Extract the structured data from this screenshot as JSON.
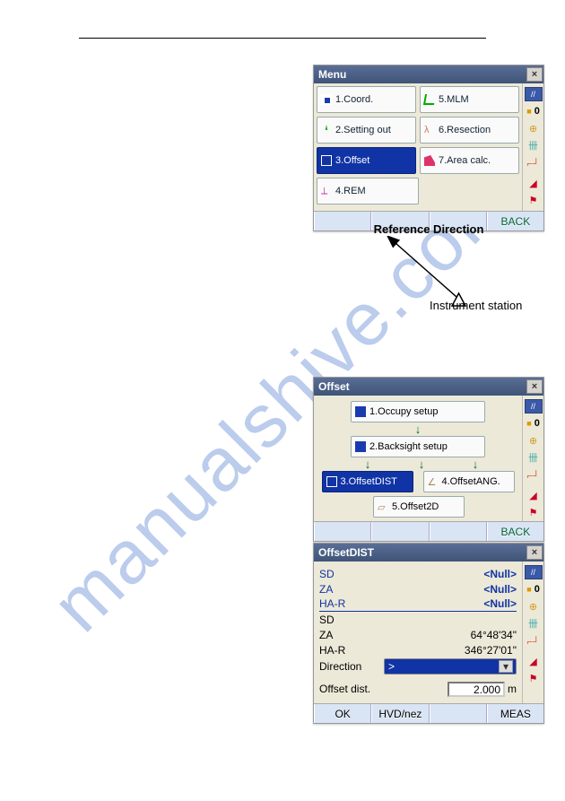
{
  "watermark": "manualshive.com",
  "screens": {
    "menu": {
      "title": "Menu",
      "items": [
        {
          "label": "1.Coord.",
          "icon": "grid"
        },
        {
          "label": "5.MLM",
          "icon": "angle-green"
        },
        {
          "label": "2.Setting out",
          "icon": "spike-green"
        },
        {
          "label": "6.Resection",
          "icon": "people"
        },
        {
          "label": "3.Offset",
          "icon": "offset-white",
          "selected": true
        },
        {
          "label": "7.Area calc.",
          "icon": "area-pink"
        },
        {
          "label": "4.REM",
          "icon": "rem-pink"
        }
      ],
      "softkeys": [
        "",
        "",
        "",
        "BACK"
      ]
    },
    "offset": {
      "title": "Offset",
      "steps": [
        {
          "label": "1.Occupy setup",
          "icon": "grid"
        },
        {
          "label": "2.Backsight setup",
          "icon": "grid"
        },
        {
          "label": "3.OffsetDIST",
          "icon": "offset-white",
          "selected": true
        },
        {
          "label": "4.OffsetANG.",
          "icon": "angle"
        },
        {
          "label": "5.Offset2D",
          "icon": "plane"
        }
      ],
      "softkeys": [
        "",
        "",
        "",
        "BACK"
      ]
    },
    "offsetdist": {
      "title": "OffsetDIST",
      "null_rows": [
        {
          "label": "SD",
          "value": "<Null>"
        },
        {
          "label": "ZA",
          "value": "<Null>"
        },
        {
          "label": "HA-R",
          "value": "<Null>"
        }
      ],
      "meas_rows": [
        {
          "label": "SD",
          "value": ""
        },
        {
          "label": "ZA",
          "value": "64°48'34\""
        },
        {
          "label": "HA-R",
          "value": "346°27'01\""
        }
      ],
      "direction": {
        "label": "Direction",
        "value": ">"
      },
      "offset": {
        "label": "Offset dist.",
        "value": "2.000",
        "unit": "m"
      },
      "softkeys": [
        "OK",
        "HVD/nez",
        "",
        "MEAS"
      ]
    }
  },
  "side": {
    "batt": "//",
    "zero": "0",
    "target": "⊕",
    "ruler": "卌",
    "flex": "⌐┘",
    "tri": "◢",
    "flag": "⚑"
  },
  "diagram": {
    "ref_direction": "Reference Direction",
    "instrument": "Instrument station"
  }
}
